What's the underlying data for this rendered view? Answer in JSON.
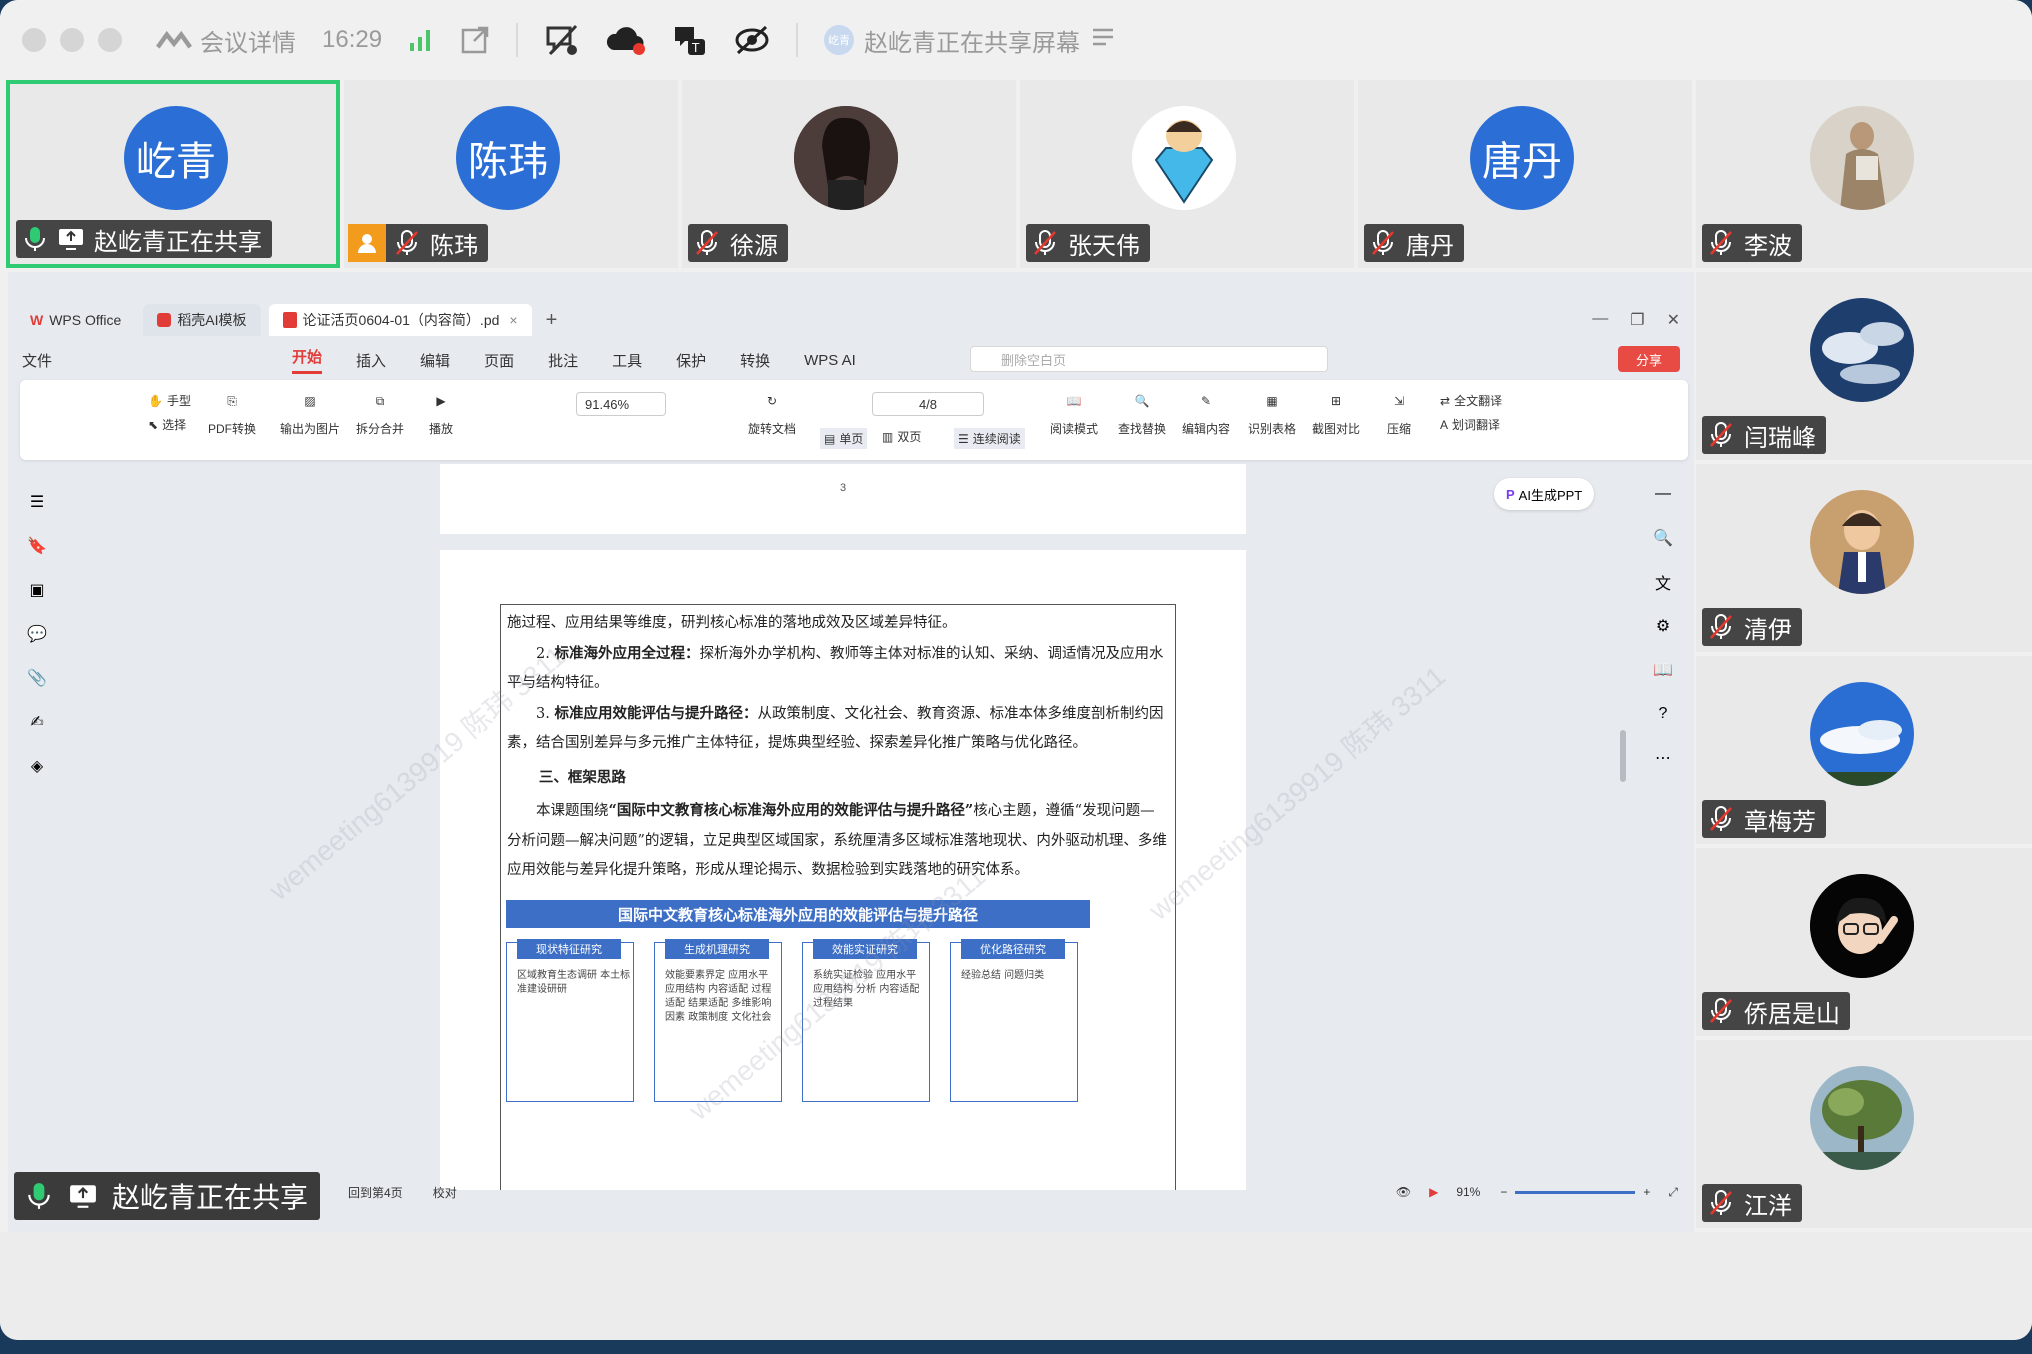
{
  "titlebar": {
    "meeting_label": "会议详情",
    "time": "16:29",
    "sharing_label": "赵屹青正在共享屏幕",
    "sharer_avatar_text": "屹青"
  },
  "participants": [
    {
      "avatar_text": "屹青",
      "name": "赵屹青正在共享",
      "avatar_type": "text-blue",
      "status": "mic-on-sharing"
    },
    {
      "avatar_text": "陈玮",
      "name": "陈玮",
      "avatar_type": "text-blue",
      "status": "host-muted"
    },
    {
      "avatar_text": "",
      "name": "徐源",
      "avatar_type": "photo-woman",
      "status": "muted"
    },
    {
      "avatar_text": "",
      "name": "张天伟",
      "avatar_type": "cartoon-diamond",
      "status": "muted"
    },
    {
      "avatar_text": "唐丹",
      "name": "唐丹",
      "avatar_type": "text-blue",
      "status": "muted"
    },
    {
      "avatar_text": "",
      "name": "李波",
      "avatar_type": "photo-statue",
      "status": "muted"
    },
    {
      "avatar_text": "",
      "name": "闫瑞峰",
      "avatar_type": "photo-clouds-dark",
      "status": "muted"
    },
    {
      "avatar_text": "",
      "name": "清伊",
      "avatar_type": "photo-child",
      "status": "muted"
    },
    {
      "avatar_text": "",
      "name": "章梅芳",
      "avatar_type": "photo-sky",
      "status": "muted"
    },
    {
      "avatar_text": "",
      "name": "侨居是山",
      "avatar_type": "cartoon-avatar",
      "status": "muted"
    },
    {
      "avatar_text": "",
      "name": "江洋",
      "avatar_type": "photo-tree",
      "status": "muted"
    }
  ],
  "wps": {
    "tabs": [
      "WPS Office",
      "稻壳AI模板",
      "论证活页0604-01（内容简）.pd"
    ],
    "menu": [
      "文件",
      "开始",
      "插入",
      "编辑",
      "页面",
      "批注",
      "工具",
      "保护",
      "转换",
      "WPS AI"
    ],
    "active_menu": "开始",
    "search_placeholder": "删除空白页",
    "share_label": "分享",
    "ribbon": {
      "hand": "手型",
      "select": "选择",
      "pdf_convert": "PDF转换",
      "export_img": "输出为图片",
      "split_merge": "拆分合并",
      "play": "播放",
      "zoom": "91.46%",
      "rotate": "旋转文档",
      "page": "4/8",
      "single": "单页",
      "double": "双页",
      "continuous": "连续阅读",
      "read_mode": "阅读模式",
      "find_replace": "查找替换",
      "edit_content": "编辑内容",
      "recognize_table": "识别表格",
      "screenshot_compare": "截图对比",
      "compress": "压缩",
      "full_translate": "全文翻译",
      "word_translate": "划词翻译"
    },
    "ai_ppt": "AI生成PPT",
    "prev_page_number": "3",
    "status": {
      "back_to": "回到第4页",
      "proofread": "校对",
      "zoom": "91%"
    }
  },
  "document": {
    "p0": "施过程、应用结果等维度，研判核心标准的落地成效及区域差异特征。",
    "p1_num": "2.",
    "p1_bold": "标准海外应用全过程：",
    "p1_text": "探析海外办学机构、教师等主体对标准的认知、采纳、调适情况及应用水平与结构特征。",
    "p2_num": "3.",
    "p2_bold": "标准应用效能评估与提升路径：",
    "p2_text": "从政策制度、文化社会、教育资源、标准本体多维度剖析制约因素，结合国别差异与多元推广主体特征，提炼典型经验、探索差异化推广策略与优化路径。",
    "h3": "三、框架思路",
    "p3_a": "本课题围绕",
    "p3_bold": "“国际中文教育核心标准海外应用的效能评估与提升路径”",
    "p3_b": "核心主题，遵循“发现问题—分析问题—解决问题”的逻辑，立足典型区域国家，系统厘清多区域标准落地现状、内外驱动机理、多维应用效能与差异化提升策略，形成从理论揭示、数据检验到实践落地的研究体系。",
    "diagram_title": "国际中文教育核心标准海外应用的效能评估与提升路径",
    "columns": [
      {
        "head": "现状特征研究",
        "body": "区域教育生态调研 本土标准建设研研"
      },
      {
        "head": "生成机理研究",
        "body": "效能要素界定 应用水平 应用结构 内容适配 过程适配 结果适配 多维影响因素 政策制度 文化社会"
      },
      {
        "head": "效能实证研究",
        "body": "系统实证检验 应用水平 应用结构 分析 内容适配 过程结果"
      },
      {
        "head": "优化路径研究",
        "body": "经验总结 问题归类"
      }
    ]
  },
  "share_overlay": "赵屹青正在共享",
  "watermark_text": "wemeeting6139919 陈玮 3311",
  "colors": {
    "accent_blue": "#2b6fd6",
    "active_border": "#2ecb73",
    "wps_red": "#e23c39",
    "host_orange": "#f29b1d"
  }
}
